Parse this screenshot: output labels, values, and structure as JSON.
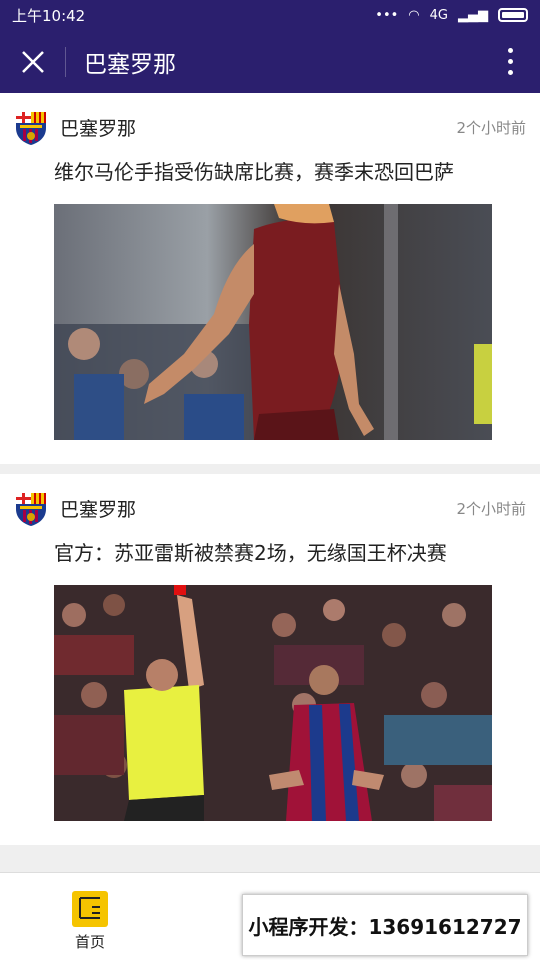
{
  "status_bar": {
    "time": "上午10:42",
    "network": "4G"
  },
  "header": {
    "title": "巴塞罗那"
  },
  "feed": [
    {
      "source": "巴塞罗那",
      "time_ago": "2个小时前",
      "headline": "维尔马伦手指受伤缺席比赛，赛季末恐回巴萨"
    },
    {
      "source": "巴塞罗那",
      "time_ago": "2个小时前",
      "headline": "官方：苏亚雷斯被禁赛2场，无缘国王杯决赛"
    }
  ],
  "tabbar": {
    "home_label": "首页"
  },
  "promo": {
    "text": "小程序开发：13691612727"
  },
  "colors": {
    "header_bg": "#2b1f6e",
    "home_icon": "#f5c400"
  }
}
